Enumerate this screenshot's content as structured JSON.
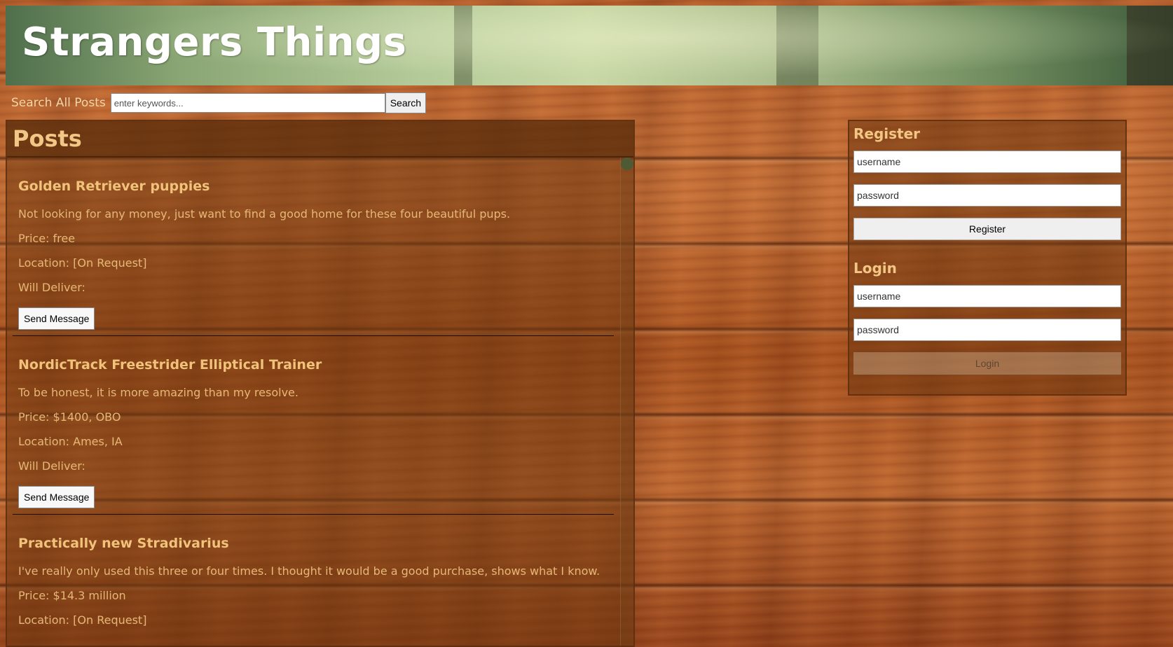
{
  "header": {
    "title": "Strangers Things"
  },
  "search": {
    "label": "Search All Posts",
    "placeholder": "enter keywords...",
    "button_label": "Search"
  },
  "posts": {
    "heading": "Posts",
    "items": [
      {
        "title": "Golden Retriever puppies",
        "description": "Not looking for any money, just want to find a good home for these four beautiful pups.",
        "price": "Price: free",
        "location": "Location: [On Request]",
        "deliver": "Will Deliver:",
        "button_label": "Send Message"
      },
      {
        "title": "NordicTrack Freestrider Elliptical Trainer",
        "description": "To be honest, it is more amazing than my resolve.",
        "price": "Price: $1400, OBO",
        "location": "Location: Ames, IA",
        "deliver": "Will Deliver:",
        "button_label": "Send Message"
      },
      {
        "title": "Practically new Stradivarius",
        "description": "I've really only used this three or four times. I thought it would be a good purchase, shows what I know.",
        "price": "Price: $14.3 million",
        "location": "Location: [On Request]"
      }
    ]
  },
  "register": {
    "heading": "Register",
    "username_placeholder": "username",
    "password_placeholder": "password",
    "button_label": "Register"
  },
  "login": {
    "heading": "Login",
    "username_placeholder": "username",
    "password_placeholder": "password",
    "button_label": "Login",
    "button_disabled": true
  },
  "colors": {
    "heading_text": "#f2c685",
    "body_text": "#e6b877",
    "panel_bg": "rgba(110,55,15,0.55)"
  }
}
